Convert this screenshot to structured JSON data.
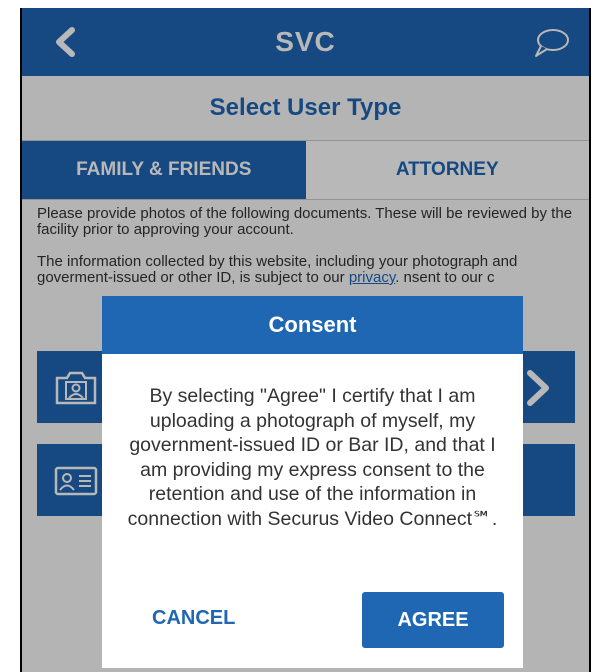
{
  "header": {
    "title": "SVC",
    "back_icon": "back-chevron-icon",
    "chat_icon": "chat-bubble-icon"
  },
  "subtitle": "Select User Type",
  "tabs": [
    {
      "label": "FAMILY & FRIENDS",
      "active": true
    },
    {
      "label": "ATTORNEY",
      "active": false
    }
  ],
  "content": {
    "para1": "Please provide photos of the following documents. These will be reviewed by the facility prior to approving your account.",
    "para2_start": "The information collected by this website, including your photograph and goverment-issued or other ID, is subject to our ",
    "privacy_link": "privacy",
    "para2_end": ". nsent to our c"
  },
  "cards": [
    {
      "icon": "camera-portrait-icon"
    },
    {
      "icon": "id-card-icon"
    }
  ],
  "dialog": {
    "title": "Consent",
    "body": "By selecting \"Agree\" I certify that I am uploading a photograph of myself, my government-issued ID or Bar ID, and that I am providing my express consent to the retention and use of the information in connection with Securus Video Connect℠.",
    "cancel_label": "CANCEL",
    "agree_label": "AGREE"
  },
  "colors": {
    "primary": "#1f66b3",
    "background": "#fafafa",
    "text": "#333333"
  }
}
